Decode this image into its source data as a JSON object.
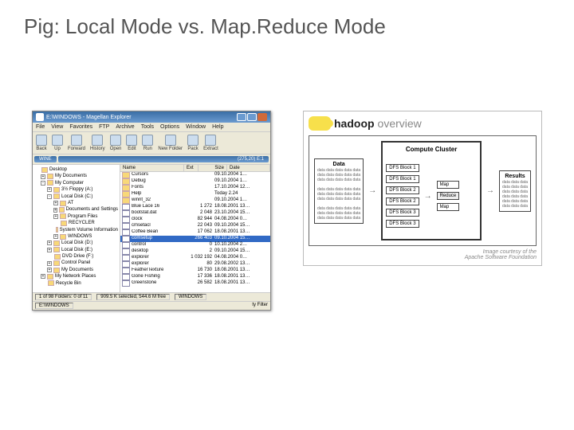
{
  "slide": {
    "title": "Pig: Local Mode vs. Map.Reduce Mode"
  },
  "explorer": {
    "windowTitle": "E:\\WINDOWS - Magellan Explorer",
    "menus": [
      "File",
      "View",
      "Favorites",
      "FTP",
      "Archive",
      "Tools",
      "Options",
      "Window",
      "Help"
    ],
    "toolbar": [
      "Back",
      "Up",
      "Forward",
      "History",
      "Open",
      "Edit",
      "Run",
      "New Folder",
      "Pack",
      "Extract"
    ],
    "addressLabel": "WINE",
    "addressField": "(275,20) E:1",
    "treeNodes": [
      {
        "label": "Desktop",
        "indent": 0,
        "sq": ""
      },
      {
        "label": "My Documents",
        "indent": 1,
        "sq": "+"
      },
      {
        "label": "My Computer",
        "indent": 1,
        "sq": "-"
      },
      {
        "label": "3½ Floppy (A:)",
        "indent": 2,
        "sq": "+"
      },
      {
        "label": "Local Disk (C:)",
        "indent": 2,
        "sq": "-"
      },
      {
        "label": "AT",
        "indent": 3,
        "sq": "+"
      },
      {
        "label": "Documents and Settings",
        "indent": 3,
        "sq": "+"
      },
      {
        "label": "Program Files",
        "indent": 3,
        "sq": "+"
      },
      {
        "label": "RECYCLER",
        "indent": 3,
        "sq": ""
      },
      {
        "label": "System Volume Information",
        "indent": 3,
        "sq": ""
      },
      {
        "label": "WINDOWS",
        "indent": 3,
        "sq": "+"
      },
      {
        "label": "Local Disk (D:)",
        "indent": 2,
        "sq": "+"
      },
      {
        "label": "Local Disk (E:)",
        "indent": 2,
        "sq": "+"
      },
      {
        "label": "DVD Drive (F:)",
        "indent": 2,
        "sq": ""
      },
      {
        "label": "Control Panel",
        "indent": 2,
        "sq": "+"
      },
      {
        "label": "My Documents",
        "indent": 2,
        "sq": "+"
      },
      {
        "label": "My Network Places",
        "indent": 1,
        "sq": "+"
      },
      {
        "label": "Recycle Bin",
        "indent": 1,
        "sq": ""
      }
    ],
    "columns": [
      "Name",
      "Ext",
      "Size",
      "Date"
    ],
    "rows": [
      {
        "name": "Cursors",
        "type": "folder",
        "size": "",
        "date": "09.10.2004 1…"
      },
      {
        "name": "Debug",
        "type": "folder",
        "size": "",
        "date": "09.10.2004 1…"
      },
      {
        "name": "Fonts",
        "type": "folder",
        "size": "",
        "date": "17.10.2004 12…"
      },
      {
        "name": "Help",
        "type": "folder",
        "size": "",
        "date": "Today 2.24"
      },
      {
        "name": "winnt_32",
        "type": "folder",
        "size": "",
        "date": "09.10.2004 1…"
      },
      {
        "name": "Blue Lace 16",
        "type": "file",
        "size": "1 272",
        "date": "18.08.2001 13…"
      },
      {
        "name": "bootstat.dat",
        "type": "file",
        "size": "2 048",
        "date": "23.10.2004 15…"
      },
      {
        "name": "clock",
        "type": "file",
        "size": "82 944",
        "date": "04.08.2004 0…"
      },
      {
        "name": "cmsetacl",
        "type": "file",
        "size": "22 043",
        "date": "09.10.2004 15…"
      },
      {
        "name": "Coffee Bean",
        "type": "file",
        "size": "17 062",
        "date": "18.08.2001 13…"
      },
      {
        "name": "comsetup",
        "type": "file",
        "size": "266 403",
        "date": "09.10.2004 15…"
      },
      {
        "name": "control",
        "type": "file",
        "size": "0",
        "date": "10.10.2004 2…"
      },
      {
        "name": "desktop",
        "type": "file",
        "size": "2",
        "date": "09.10.2004 15…"
      },
      {
        "name": "explorer",
        "type": "file",
        "size": "1 032 192",
        "date": "04.08.2004 0…"
      },
      {
        "name": "explorer",
        "type": "file",
        "size": "80",
        "date": "29.08.2002 13…"
      },
      {
        "name": "FeatherTexture",
        "type": "file",
        "size": "16 730",
        "date": "18.08.2001 13…"
      },
      {
        "name": "Gone Fishing",
        "type": "file",
        "size": "17 336",
        "date": "18.08.2001 13…"
      },
      {
        "name": "Greenstone",
        "type": "file",
        "size": "26 582",
        "date": "18.08.2001 13…"
      }
    ],
    "selectedRow": 10,
    "status": {
      "left": "1 of 98 Folders: 0 of 11",
      "mid": "909.5 K selected, 544.6 M free",
      "right": "WINDOWS",
      "taskbar": "E:\\WINDOWS"
    }
  },
  "hadoop": {
    "brand": "hadoop",
    "overview": "overview",
    "dataTitle": "Data",
    "dataLines": [
      "data data data data data",
      "data data data data data",
      "data data data data data",
      "",
      "data data data data data",
      "data data data data data",
      "data data data data data",
      "",
      "data data data data data",
      "data data data data data",
      "data data data data data"
    ],
    "clusterTitle": "Compute Cluster",
    "dfsBlocks": [
      "DFS Block 1",
      "DFS Block 1",
      "DFS Block 2",
      "DFS Block 2",
      "DFS Block 3",
      "DFS Block 3"
    ],
    "mapLabel": "Map",
    "reduceLabel": "Reduce",
    "resultsTitle": "Results",
    "resultsLines": [
      "data data data",
      "data data data",
      "data data data",
      "data data data",
      "data data data",
      "data data data"
    ],
    "credit1": "Image courtesy of the",
    "credit2": "Apache Software Foundation"
  }
}
